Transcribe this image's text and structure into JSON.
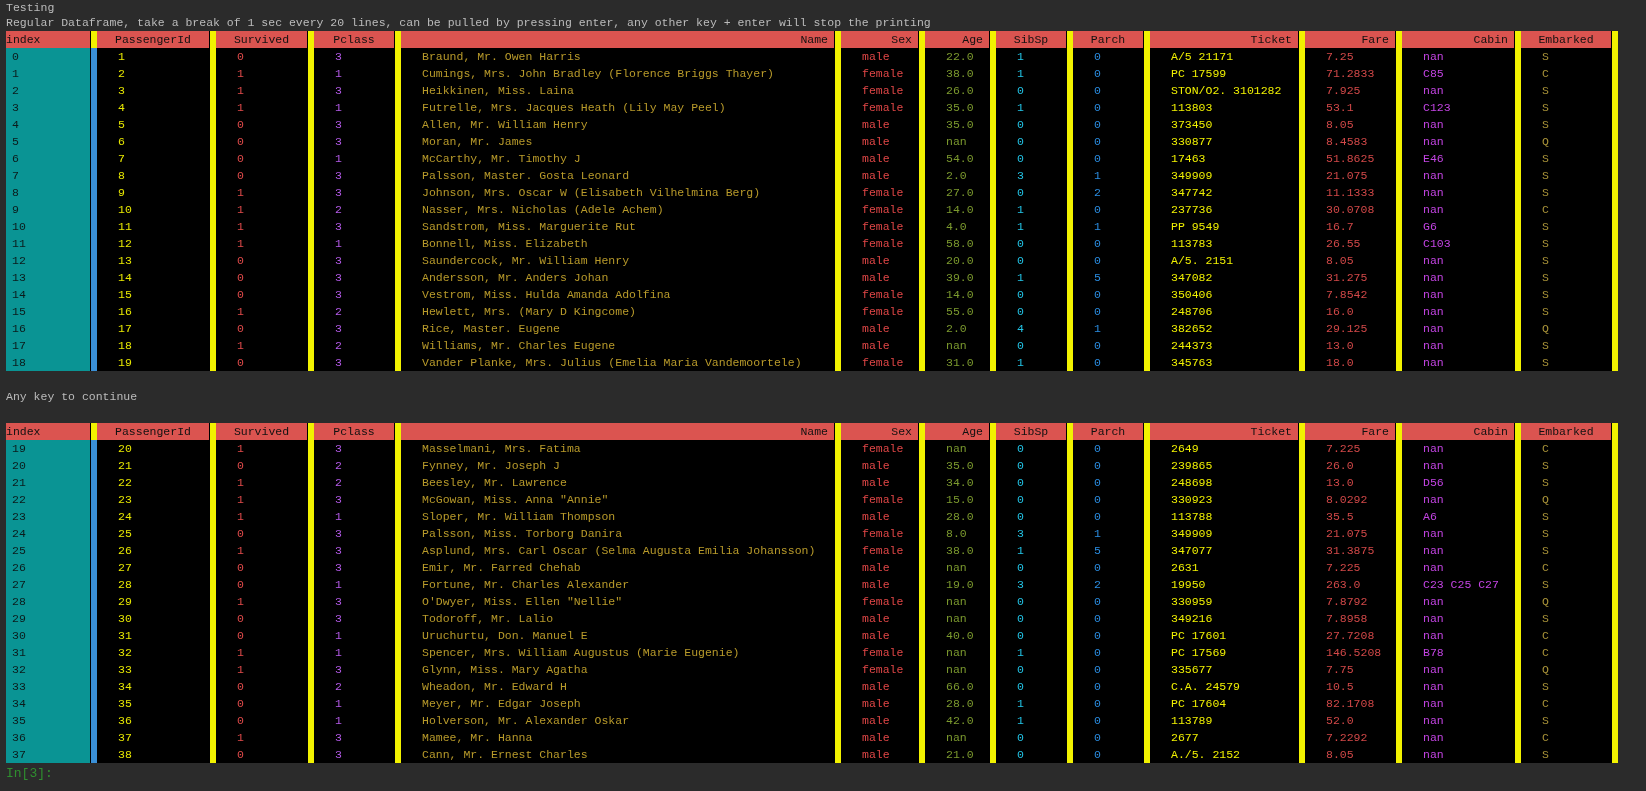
{
  "blocks": [
    {
      "kind": "text",
      "text": "Testing"
    },
    {
      "kind": "text",
      "text": "Regular Dataframe, take a break of 1 sec every 20 lines, can be pulled by pressing enter, any other key + enter will stop the printing"
    },
    {
      "kind": "table",
      "columns": [
        "index",
        "PassengerId",
        "Survived",
        "Pclass",
        "Name",
        "Sex",
        "Age",
        "SibSp",
        "Parch",
        "Ticket",
        "Fare",
        "Cabin",
        "Embarked"
      ],
      "rows": [
        [
          "0",
          "1",
          "0",
          "3",
          "Braund, Mr. Owen Harris",
          "male",
          "22.0",
          "1",
          "0",
          "A/5 21171",
          "7.25",
          "nan",
          "S"
        ],
        [
          "1",
          "2",
          "1",
          "1",
          "Cumings, Mrs. John Bradley (Florence Briggs Thayer)",
          "female",
          "38.0",
          "1",
          "0",
          "PC 17599",
          "71.2833",
          "C85",
          "C"
        ],
        [
          "2",
          "3",
          "1",
          "3",
          "Heikkinen, Miss. Laina",
          "female",
          "26.0",
          "0",
          "0",
          "STON/O2. 3101282",
          "7.925",
          "nan",
          "S"
        ],
        [
          "3",
          "4",
          "1",
          "1",
          "Futrelle, Mrs. Jacques Heath (Lily May Peel)",
          "female",
          "35.0",
          "1",
          "0",
          "113803",
          "53.1",
          "C123",
          "S"
        ],
        [
          "4",
          "5",
          "0",
          "3",
          "Allen, Mr. William Henry",
          "male",
          "35.0",
          "0",
          "0",
          "373450",
          "8.05",
          "nan",
          "S"
        ],
        [
          "5",
          "6",
          "0",
          "3",
          "Moran, Mr. James",
          "male",
          "nan",
          "0",
          "0",
          "330877",
          "8.4583",
          "nan",
          "Q"
        ],
        [
          "6",
          "7",
          "0",
          "1",
          "McCarthy, Mr. Timothy J",
          "male",
          "54.0",
          "0",
          "0",
          "17463",
          "51.8625",
          "E46",
          "S"
        ],
        [
          "7",
          "8",
          "0",
          "3",
          "Palsson, Master. Gosta Leonard",
          "male",
          "2.0",
          "3",
          "1",
          "349909",
          "21.075",
          "nan",
          "S"
        ],
        [
          "8",
          "9",
          "1",
          "3",
          "Johnson, Mrs. Oscar W (Elisabeth Vilhelmina Berg)",
          "female",
          "27.0",
          "0",
          "2",
          "347742",
          "11.1333",
          "nan",
          "S"
        ],
        [
          "9",
          "10",
          "1",
          "2",
          "Nasser, Mrs. Nicholas (Adele Achem)",
          "female",
          "14.0",
          "1",
          "0",
          "237736",
          "30.0708",
          "nan",
          "C"
        ],
        [
          "10",
          "11",
          "1",
          "3",
          "Sandstrom, Miss. Marguerite Rut",
          "female",
          "4.0",
          "1",
          "1",
          "PP 9549",
          "16.7",
          "G6",
          "S"
        ],
        [
          "11",
          "12",
          "1",
          "1",
          "Bonnell, Miss. Elizabeth",
          "female",
          "58.0",
          "0",
          "0",
          "113783",
          "26.55",
          "C103",
          "S"
        ],
        [
          "12",
          "13",
          "0",
          "3",
          "Saundercock, Mr. William Henry",
          "male",
          "20.0",
          "0",
          "0",
          "A/5. 2151",
          "8.05",
          "nan",
          "S"
        ],
        [
          "13",
          "14",
          "0",
          "3",
          "Andersson, Mr. Anders Johan",
          "male",
          "39.0",
          "1",
          "5",
          "347082",
          "31.275",
          "nan",
          "S"
        ],
        [
          "14",
          "15",
          "0",
          "3",
          "Vestrom, Miss. Hulda Amanda Adolfina",
          "female",
          "14.0",
          "0",
          "0",
          "350406",
          "7.8542",
          "nan",
          "S"
        ],
        [
          "15",
          "16",
          "1",
          "2",
          "Hewlett, Mrs. (Mary D Kingcome)",
          "female",
          "55.0",
          "0",
          "0",
          "248706",
          "16.0",
          "nan",
          "S"
        ],
        [
          "16",
          "17",
          "0",
          "3",
          "Rice, Master. Eugene",
          "male",
          "2.0",
          "4",
          "1",
          "382652",
          "29.125",
          "nan",
          "Q"
        ],
        [
          "17",
          "18",
          "1",
          "2",
          "Williams, Mr. Charles Eugene",
          "male",
          "nan",
          "0",
          "0",
          "244373",
          "13.0",
          "nan",
          "S"
        ],
        [
          "18",
          "19",
          "0",
          "3",
          "Vander Planke, Mrs. Julius (Emelia Maria Vandemoortele)",
          "female",
          "31.0",
          "1",
          "0",
          "345763",
          "18.0",
          "nan",
          "S"
        ]
      ]
    },
    {
      "kind": "text",
      "text": "Any key to continue"
    },
    {
      "kind": "table",
      "columns": [
        "index",
        "PassengerId",
        "Survived",
        "Pclass",
        "Name",
        "Sex",
        "Age",
        "SibSp",
        "Parch",
        "Ticket",
        "Fare",
        "Cabin",
        "Embarked"
      ],
      "rows": [
        [
          "19",
          "20",
          "1",
          "3",
          "Masselmani, Mrs. Fatima",
          "female",
          "nan",
          "0",
          "0",
          "2649",
          "7.225",
          "nan",
          "C"
        ],
        [
          "20",
          "21",
          "0",
          "2",
          "Fynney, Mr. Joseph J",
          "male",
          "35.0",
          "0",
          "0",
          "239865",
          "26.0",
          "nan",
          "S"
        ],
        [
          "21",
          "22",
          "1",
          "2",
          "Beesley, Mr. Lawrence",
          "male",
          "34.0",
          "0",
          "0",
          "248698",
          "13.0",
          "D56",
          "S"
        ],
        [
          "22",
          "23",
          "1",
          "3",
          "McGowan, Miss. Anna \"Annie\"",
          "female",
          "15.0",
          "0",
          "0",
          "330923",
          "8.0292",
          "nan",
          "Q"
        ],
        [
          "23",
          "24",
          "1",
          "1",
          "Sloper, Mr. William Thompson",
          "male",
          "28.0",
          "0",
          "0",
          "113788",
          "35.5",
          "A6",
          "S"
        ],
        [
          "24",
          "25",
          "0",
          "3",
          "Palsson, Miss. Torborg Danira",
          "female",
          "8.0",
          "3",
          "1",
          "349909",
          "21.075",
          "nan",
          "S"
        ],
        [
          "25",
          "26",
          "1",
          "3",
          "Asplund, Mrs. Carl Oscar (Selma Augusta Emilia Johansson)",
          "female",
          "38.0",
          "1",
          "5",
          "347077",
          "31.3875",
          "nan",
          "S"
        ],
        [
          "26",
          "27",
          "0",
          "3",
          "Emir, Mr. Farred Chehab",
          "male",
          "nan",
          "0",
          "0",
          "2631",
          "7.225",
          "nan",
          "C"
        ],
        [
          "27",
          "28",
          "0",
          "1",
          "Fortune, Mr. Charles Alexander",
          "male",
          "19.0",
          "3",
          "2",
          "19950",
          "263.0",
          "C23 C25 C27",
          "S"
        ],
        [
          "28",
          "29",
          "1",
          "3",
          "O'Dwyer, Miss. Ellen \"Nellie\"",
          "female",
          "nan",
          "0",
          "0",
          "330959",
          "7.8792",
          "nan",
          "Q"
        ],
        [
          "29",
          "30",
          "0",
          "3",
          "Todoroff, Mr. Lalio",
          "male",
          "nan",
          "0",
          "0",
          "349216",
          "7.8958",
          "nan",
          "S"
        ],
        [
          "30",
          "31",
          "0",
          "1",
          "Uruchurtu, Don. Manuel E",
          "male",
          "40.0",
          "0",
          "0",
          "PC 17601",
          "27.7208",
          "nan",
          "C"
        ],
        [
          "31",
          "32",
          "1",
          "1",
          "Spencer, Mrs. William Augustus (Marie Eugenie)",
          "female",
          "nan",
          "1",
          "0",
          "PC 17569",
          "146.5208",
          "B78",
          "C"
        ],
        [
          "32",
          "33",
          "1",
          "3",
          "Glynn, Miss. Mary Agatha",
          "female",
          "nan",
          "0",
          "0",
          "335677",
          "7.75",
          "nan",
          "Q"
        ],
        [
          "33",
          "34",
          "0",
          "2",
          "Wheadon, Mr. Edward H",
          "male",
          "66.0",
          "0",
          "0",
          "C.A. 24579",
          "10.5",
          "nan",
          "S"
        ],
        [
          "34",
          "35",
          "0",
          "1",
          "Meyer, Mr. Edgar Joseph",
          "male",
          "28.0",
          "1",
          "0",
          "PC 17604",
          "82.1708",
          "nan",
          "C"
        ],
        [
          "35",
          "36",
          "0",
          "1",
          "Holverson, Mr. Alexander Oskar",
          "male",
          "42.0",
          "1",
          "0",
          "113789",
          "52.0",
          "nan",
          "S"
        ],
        [
          "36",
          "37",
          "1",
          "3",
          "Mamee, Mr. Hanna",
          "male",
          "nan",
          "0",
          "0",
          "2677",
          "7.2292",
          "nan",
          "C"
        ],
        [
          "37",
          "38",
          "0",
          "3",
          "Cann, Mr. Ernest Charles",
          "male",
          "21.0",
          "0",
          "0",
          "A./5. 2152",
          "8.05",
          "nan",
          "S"
        ]
      ]
    },
    {
      "kind": "prompt",
      "text": "In[3]:"
    }
  ]
}
